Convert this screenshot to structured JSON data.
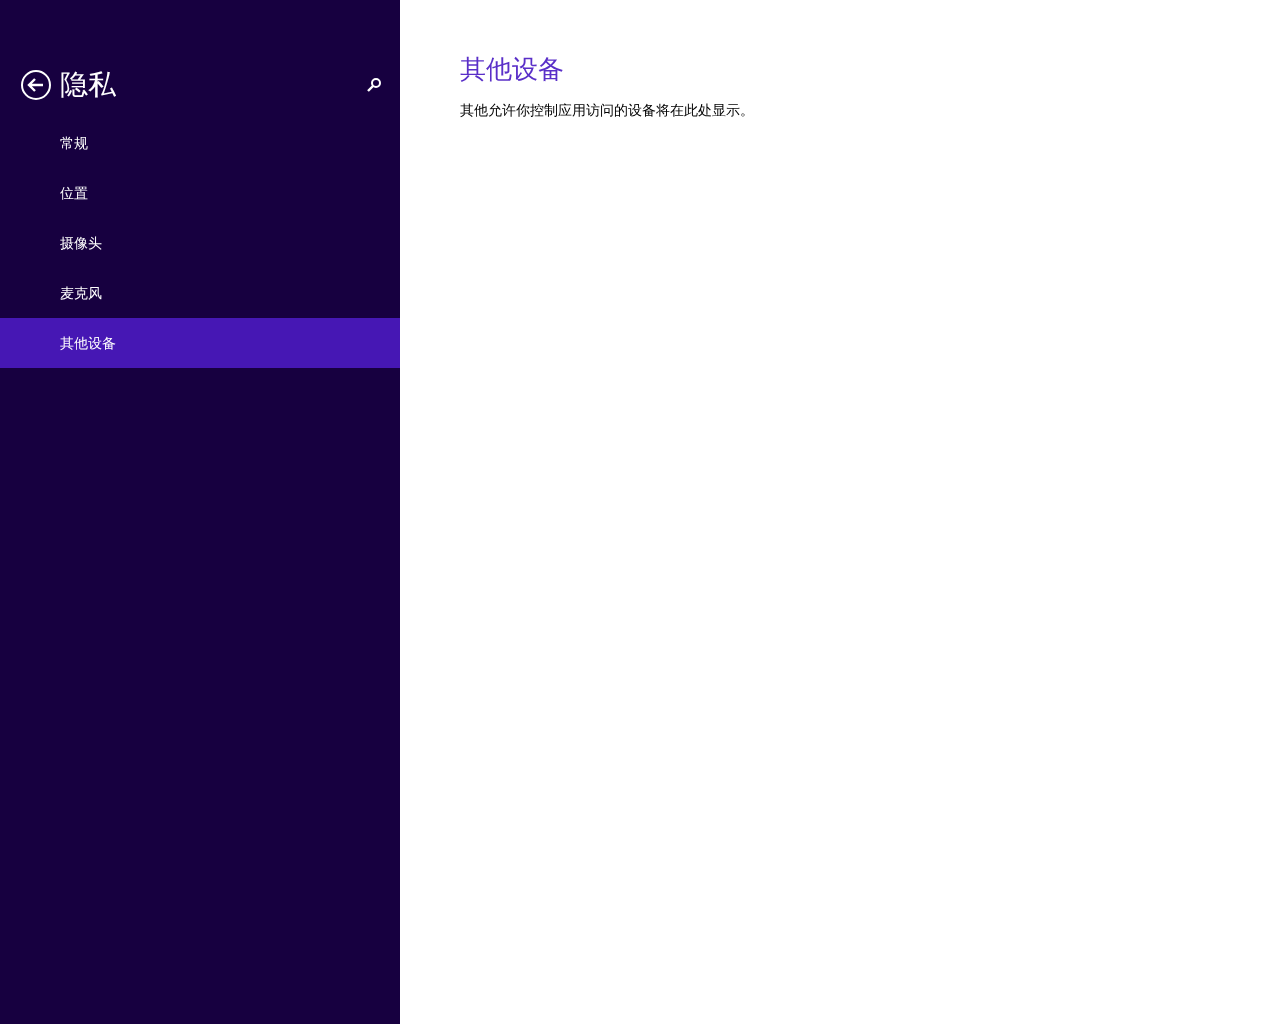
{
  "sidebar": {
    "title": "隐私",
    "items": [
      {
        "label": "常规",
        "selected": false
      },
      {
        "label": "位置",
        "selected": false
      },
      {
        "label": "摄像头",
        "selected": false
      },
      {
        "label": "麦克风",
        "selected": false
      },
      {
        "label": "其他设备",
        "selected": true
      }
    ]
  },
  "content": {
    "heading": "其他设备",
    "description": "其他允许你控制应用访问的设备将在此处显示。"
  }
}
